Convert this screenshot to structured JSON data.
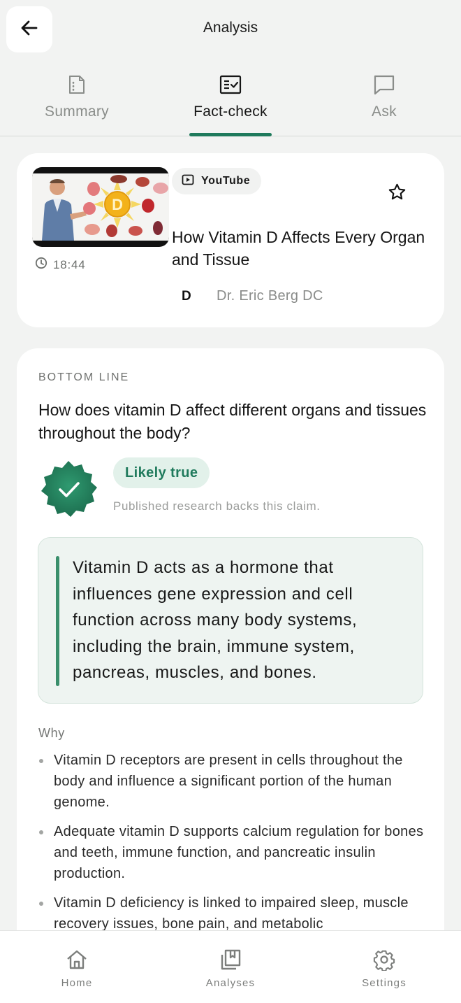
{
  "header": {
    "title": "Analysis",
    "back_icon": "arrow-left-icon"
  },
  "tabs": [
    {
      "label": "Summary",
      "icon": "document-icon",
      "active": false
    },
    {
      "label": "Fact-check",
      "icon": "checklist-icon",
      "active": true
    },
    {
      "label": "Ask",
      "icon": "chat-bubble-icon",
      "active": false
    }
  ],
  "video": {
    "source": "YouTube",
    "title": "How Vitamin D Affects Every Organ and Tissue",
    "duration": "18:44",
    "channel_initial": "D",
    "channel_name": "Dr. Eric Berg DC",
    "thumbnail_letter": "D"
  },
  "bottom_line": {
    "section_label": "BOTTOM LINE",
    "question": "How does vitamin D affect different organs and tissues throughout the body?",
    "verdict": "Likely true",
    "verdict_caption": "Published research backs this claim.",
    "claim": "Vitamin D acts as a hormone that influences gene expression and cell function across many body systems, including the brain, immune system, pancreas, muscles, and bones.",
    "why_label": "Why",
    "why_items": [
      "Vitamin D receptors are present in cells throughout the body and influence a significant portion of the human genome.",
      "Adequate vitamin D supports calcium regulation for bones and teeth, immune function, and pancreatic insulin production.",
      "Vitamin D deficiency is linked to impaired sleep, muscle recovery issues, bone pain, and metabolic"
    ]
  },
  "bottom_nav": [
    {
      "label": "Home",
      "icon": "home-icon"
    },
    {
      "label": "Analyses",
      "icon": "bookmark-stack-icon"
    },
    {
      "label": "Settings",
      "icon": "gear-icon"
    }
  ],
  "colors": {
    "accent": "#1f7a5c",
    "verdict_chip_bg": "#e2f1ea",
    "claim_bg": "#eef4f1",
    "page_bg": "#f2f3f2"
  }
}
